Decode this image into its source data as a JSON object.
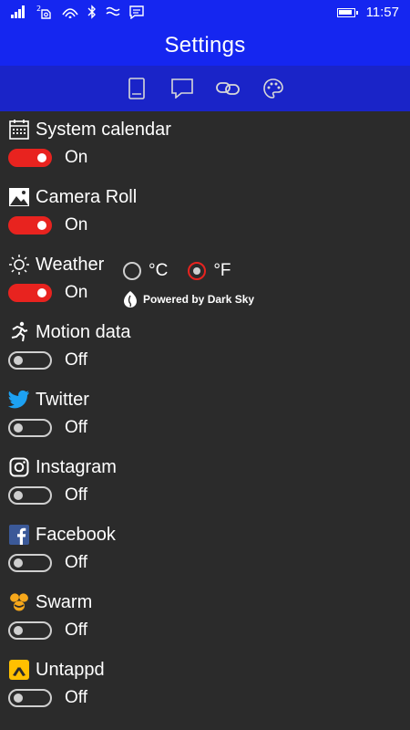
{
  "status_bar": {
    "time": "11:57",
    "indicators": [
      "signal-icon",
      "sim2-icon",
      "wifi-icon",
      "bluetooth-icon",
      "vibrate-icon",
      "message-icon",
      "battery-icon"
    ]
  },
  "header": {
    "title": "Settings"
  },
  "tabs": [
    {
      "icon": "book-icon"
    },
    {
      "icon": "chat-icon"
    },
    {
      "icon": "link-icon"
    },
    {
      "icon": "palette-icon"
    }
  ],
  "items": [
    {
      "label": "System calendar",
      "icon": "calendar-icon",
      "state": "On"
    },
    {
      "label": "Camera Roll",
      "icon": "image-icon",
      "state": "On"
    },
    {
      "label": "Weather",
      "icon": "sun-icon",
      "state": "On"
    },
    {
      "label": "Motion data",
      "icon": "running-icon",
      "state": "Off"
    },
    {
      "label": "Twitter",
      "icon": "twitter-icon",
      "state": "Off"
    },
    {
      "label": "Instagram",
      "icon": "instagram-icon",
      "state": "Off"
    },
    {
      "label": "Facebook",
      "icon": "facebook-icon",
      "state": "Off"
    },
    {
      "label": "Swarm",
      "icon": "swarm-icon",
      "state": "Off"
    },
    {
      "label": "Untappd",
      "icon": "untappd-icon",
      "state": "Off"
    }
  ],
  "weather_units": {
    "celsius_label": "°C",
    "fahrenheit_label": "°F",
    "selected": "°F"
  },
  "attribution": {
    "text": "Powered by Dark Sky",
    "icon": "darksky-icon"
  },
  "colors": {
    "accent": "#1526f0",
    "toggle_on": "#e8231f",
    "background": "#2b2b2b"
  }
}
